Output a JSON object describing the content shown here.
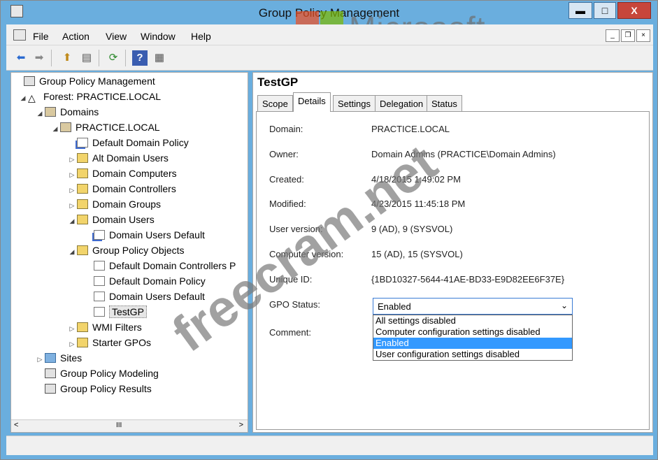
{
  "window": {
    "title": "Group Policy Management",
    "min_label": "▬",
    "max_label": "□",
    "close_label": "X"
  },
  "watermark": {
    "brand": "Microsoft",
    "site": "freecram.net"
  },
  "menubar": {
    "items": [
      "File",
      "Action",
      "View",
      "Window",
      "Help"
    ],
    "mdi_min": "_",
    "mdi_restore": "❐",
    "mdi_close": "×"
  },
  "toolbar": {
    "back": "⬅",
    "forward": "➡",
    "up": "⬆",
    "show_hide": "▤",
    "refresh": "⟳",
    "help": "?",
    "properties": "▦"
  },
  "tree": {
    "root": "Group Policy Management",
    "forest": "Forest: PRACTICE.LOCAL",
    "domains": "Domains",
    "domain": "PRACTICE.LOCAL",
    "default_domain_policy_link": "Default Domain Policy",
    "ous": [
      "Alt Domain Users",
      "Domain Computers",
      "Domain Controllers",
      "Domain Groups",
      "Domain Users"
    ],
    "domain_users_default_link": "Domain Users Default",
    "gpo_container": "Group Policy Objects",
    "gpos": [
      "Default Domain Controllers P",
      "Default Domain Policy",
      "Domain Users Default",
      "TestGP"
    ],
    "wmi_filters": "WMI Filters",
    "starter_gpos": "Starter GPOs",
    "sites": "Sites",
    "modeling": "Group Policy Modeling",
    "results": "Group Policy Results",
    "scroll_thumb": "III"
  },
  "details": {
    "gpo_name": "TestGP",
    "tabs": [
      "Scope",
      "Details",
      "Settings",
      "Delegation",
      "Status"
    ],
    "active_tab": "Details",
    "fields": [
      {
        "label": "Domain:",
        "value": "PRACTICE.LOCAL"
      },
      {
        "label": "Owner:",
        "value": "Domain Admins (PRACTICE\\Domain Admins)"
      },
      {
        "label": "Created:",
        "value": "4/18/2015 1:49:02 PM"
      },
      {
        "label": "Modified:",
        "value": "4/23/2015 11:45:18 PM"
      },
      {
        "label": "User version:",
        "value": "9 (AD), 9 (SYSVOL)"
      },
      {
        "label": "Computer version:",
        "value": "15 (AD), 15 (SYSVOL)"
      },
      {
        "label": "Unique ID:",
        "value": "{1BD10327-5644-41AE-BD33-E9D82EE6F37E}"
      }
    ],
    "gpo_status_label": "GPO Status:",
    "gpo_status_value": "Enabled",
    "gpo_status_options": [
      "All settings disabled",
      "Computer configuration settings disabled",
      "Enabled",
      "User configuration settings disabled"
    ],
    "comment_label": "Comment:"
  }
}
